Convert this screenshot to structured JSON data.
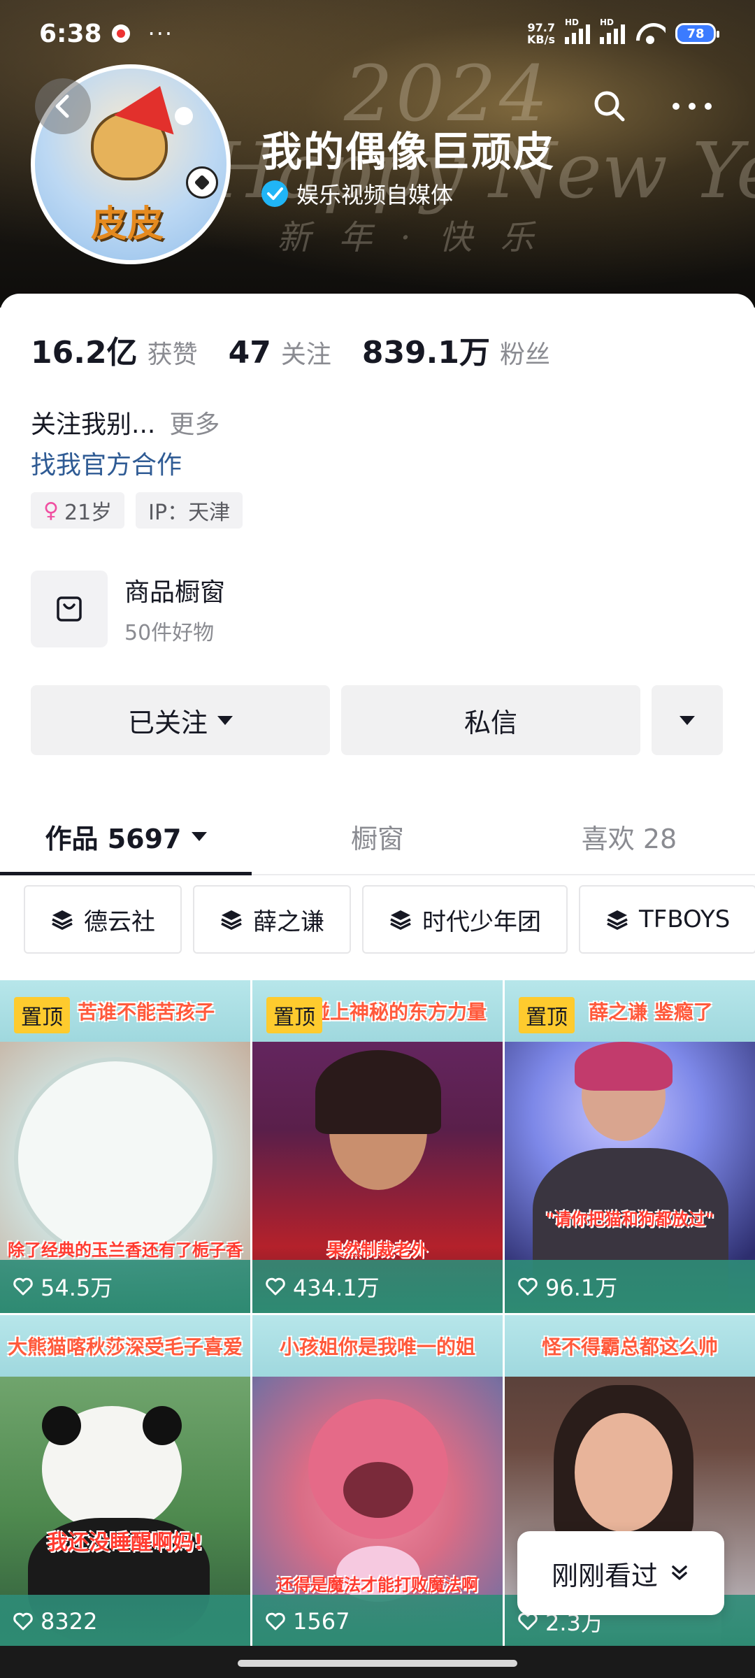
{
  "status_bar": {
    "time": "6:38",
    "net_speed_value": "97.7",
    "net_speed_unit": "KB/s",
    "signal_1_label": "HD",
    "signal_2_label": "HD",
    "battery": "78"
  },
  "banner": {
    "deco_year": "2024",
    "deco_happy": "Happy New Year",
    "deco_cn": "新年·快乐"
  },
  "profile": {
    "name": "我的偶像巨顽皮",
    "verify_label": "娱乐视频自媒体",
    "avatar_text": "皮皮"
  },
  "stats": [
    {
      "value": "16.2亿",
      "label": "获赞"
    },
    {
      "value": "47",
      "label": "关注"
    },
    {
      "value": "839.1万",
      "label": "粉丝"
    }
  ],
  "bio": {
    "text": "关注我别...",
    "more": "更多",
    "coop_link": "找我官方合作"
  },
  "tags": {
    "age": "21岁",
    "ip": "IP：天津"
  },
  "shop": {
    "title": "商品橱窗",
    "subtitle": "50件好物"
  },
  "actions": {
    "follow": "已关注",
    "message": "私信"
  },
  "tabs": [
    {
      "label": "作品 5697"
    },
    {
      "label": "橱窗"
    },
    {
      "label": "喜欢 28"
    }
  ],
  "chips": [
    {
      "label": "德云社"
    },
    {
      "label": "薛之谦"
    },
    {
      "label": "时代少年团"
    },
    {
      "label": "TFBOYS"
    }
  ],
  "videos": [
    {
      "pinned": "置顶",
      "header": "苦谁不能苦孩子",
      "caption": "除了经典的玉兰香还有了栀子香",
      "likes": "54.5万"
    },
    {
      "pinned": "置顶",
      "header": "碰上神秘的东方力量",
      "caption": "果然制裁老外",
      "likes": "434.1万"
    },
    {
      "pinned": "置顶",
      "header": "薛之谦 鉴瘾了",
      "caption": "\"请你把猫和狗都放过\"",
      "likes": "96.1万"
    },
    {
      "pinned": "",
      "header": "大熊猫喀秋莎深受毛子喜爱",
      "caption": "我还没睡醒啊妈!",
      "likes": "8322"
    },
    {
      "pinned": "",
      "header": "小孩姐你是我唯一的姐",
      "caption": "还得是魔法才能打败魔法啊",
      "likes": "1567"
    },
    {
      "pinned": "",
      "header": "怪不得霸总都这么帅",
      "caption": "",
      "likes": "2.3万"
    }
  ],
  "recent": {
    "label": "刚刚看过"
  }
}
